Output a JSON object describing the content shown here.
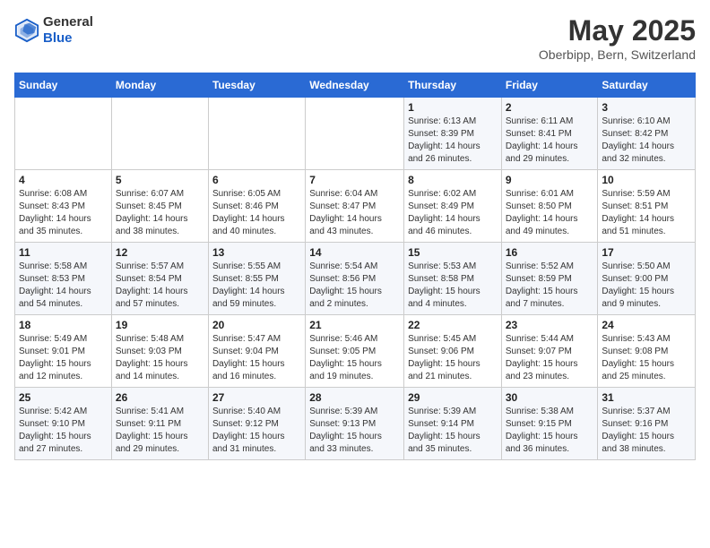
{
  "header": {
    "logo_general": "General",
    "logo_blue": "Blue",
    "month": "May 2025",
    "location": "Oberbipp, Bern, Switzerland"
  },
  "days_of_week": [
    "Sunday",
    "Monday",
    "Tuesday",
    "Wednesday",
    "Thursday",
    "Friday",
    "Saturday"
  ],
  "weeks": [
    [
      {
        "day": "",
        "info": ""
      },
      {
        "day": "",
        "info": ""
      },
      {
        "day": "",
        "info": ""
      },
      {
        "day": "",
        "info": ""
      },
      {
        "day": "1",
        "info": "Sunrise: 6:13 AM\nSunset: 8:39 PM\nDaylight: 14 hours\nand 26 minutes."
      },
      {
        "day": "2",
        "info": "Sunrise: 6:11 AM\nSunset: 8:41 PM\nDaylight: 14 hours\nand 29 minutes."
      },
      {
        "day": "3",
        "info": "Sunrise: 6:10 AM\nSunset: 8:42 PM\nDaylight: 14 hours\nand 32 minutes."
      }
    ],
    [
      {
        "day": "4",
        "info": "Sunrise: 6:08 AM\nSunset: 8:43 PM\nDaylight: 14 hours\nand 35 minutes."
      },
      {
        "day": "5",
        "info": "Sunrise: 6:07 AM\nSunset: 8:45 PM\nDaylight: 14 hours\nand 38 minutes."
      },
      {
        "day": "6",
        "info": "Sunrise: 6:05 AM\nSunset: 8:46 PM\nDaylight: 14 hours\nand 40 minutes."
      },
      {
        "day": "7",
        "info": "Sunrise: 6:04 AM\nSunset: 8:47 PM\nDaylight: 14 hours\nand 43 minutes."
      },
      {
        "day": "8",
        "info": "Sunrise: 6:02 AM\nSunset: 8:49 PM\nDaylight: 14 hours\nand 46 minutes."
      },
      {
        "day": "9",
        "info": "Sunrise: 6:01 AM\nSunset: 8:50 PM\nDaylight: 14 hours\nand 49 minutes."
      },
      {
        "day": "10",
        "info": "Sunrise: 5:59 AM\nSunset: 8:51 PM\nDaylight: 14 hours\nand 51 minutes."
      }
    ],
    [
      {
        "day": "11",
        "info": "Sunrise: 5:58 AM\nSunset: 8:53 PM\nDaylight: 14 hours\nand 54 minutes."
      },
      {
        "day": "12",
        "info": "Sunrise: 5:57 AM\nSunset: 8:54 PM\nDaylight: 14 hours\nand 57 minutes."
      },
      {
        "day": "13",
        "info": "Sunrise: 5:55 AM\nSunset: 8:55 PM\nDaylight: 14 hours\nand 59 minutes."
      },
      {
        "day": "14",
        "info": "Sunrise: 5:54 AM\nSunset: 8:56 PM\nDaylight: 15 hours\nand 2 minutes."
      },
      {
        "day": "15",
        "info": "Sunrise: 5:53 AM\nSunset: 8:58 PM\nDaylight: 15 hours\nand 4 minutes."
      },
      {
        "day": "16",
        "info": "Sunrise: 5:52 AM\nSunset: 8:59 PM\nDaylight: 15 hours\nand 7 minutes."
      },
      {
        "day": "17",
        "info": "Sunrise: 5:50 AM\nSunset: 9:00 PM\nDaylight: 15 hours\nand 9 minutes."
      }
    ],
    [
      {
        "day": "18",
        "info": "Sunrise: 5:49 AM\nSunset: 9:01 PM\nDaylight: 15 hours\nand 12 minutes."
      },
      {
        "day": "19",
        "info": "Sunrise: 5:48 AM\nSunset: 9:03 PM\nDaylight: 15 hours\nand 14 minutes."
      },
      {
        "day": "20",
        "info": "Sunrise: 5:47 AM\nSunset: 9:04 PM\nDaylight: 15 hours\nand 16 minutes."
      },
      {
        "day": "21",
        "info": "Sunrise: 5:46 AM\nSunset: 9:05 PM\nDaylight: 15 hours\nand 19 minutes."
      },
      {
        "day": "22",
        "info": "Sunrise: 5:45 AM\nSunset: 9:06 PM\nDaylight: 15 hours\nand 21 minutes."
      },
      {
        "day": "23",
        "info": "Sunrise: 5:44 AM\nSunset: 9:07 PM\nDaylight: 15 hours\nand 23 minutes."
      },
      {
        "day": "24",
        "info": "Sunrise: 5:43 AM\nSunset: 9:08 PM\nDaylight: 15 hours\nand 25 minutes."
      }
    ],
    [
      {
        "day": "25",
        "info": "Sunrise: 5:42 AM\nSunset: 9:10 PM\nDaylight: 15 hours\nand 27 minutes."
      },
      {
        "day": "26",
        "info": "Sunrise: 5:41 AM\nSunset: 9:11 PM\nDaylight: 15 hours\nand 29 minutes."
      },
      {
        "day": "27",
        "info": "Sunrise: 5:40 AM\nSunset: 9:12 PM\nDaylight: 15 hours\nand 31 minutes."
      },
      {
        "day": "28",
        "info": "Sunrise: 5:39 AM\nSunset: 9:13 PM\nDaylight: 15 hours\nand 33 minutes."
      },
      {
        "day": "29",
        "info": "Sunrise: 5:39 AM\nSunset: 9:14 PM\nDaylight: 15 hours\nand 35 minutes."
      },
      {
        "day": "30",
        "info": "Sunrise: 5:38 AM\nSunset: 9:15 PM\nDaylight: 15 hours\nand 36 minutes."
      },
      {
        "day": "31",
        "info": "Sunrise: 5:37 AM\nSunset: 9:16 PM\nDaylight: 15 hours\nand 38 minutes."
      }
    ]
  ]
}
